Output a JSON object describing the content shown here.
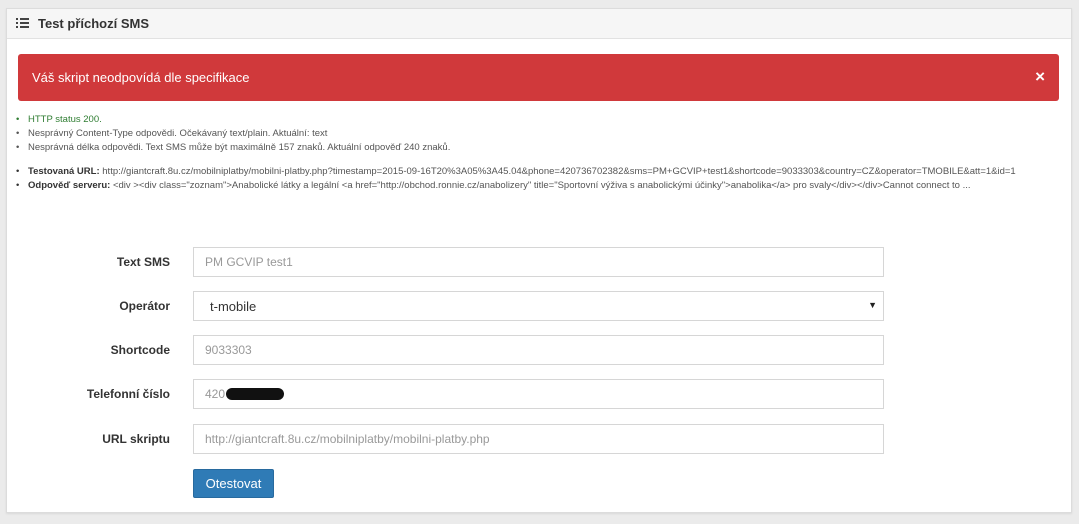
{
  "panel": {
    "title": "Test příchozí SMS",
    "icon": "list-icon"
  },
  "alert": {
    "text": "Váš skript neodpovídá dle specifikace",
    "close_icon": "×",
    "color": "#d0393b"
  },
  "messages": [
    {
      "text": "HTTP status 200.",
      "status": "ok"
    },
    {
      "text": "Nesprávný Content-Type odpovědi. Očekávaný text/plain. Aktuální: text",
      "status": "err"
    },
    {
      "text": "Nesprávná délka odpovědi. Text SMS může být maximálně 157 znaků. Aktuální odpověď 240 znaků.",
      "status": "err"
    }
  ],
  "details": {
    "tested_url_label": "Testovaná URL:",
    "tested_url_value": "http://giantcraft.8u.cz/mobilniplatby/mobilni-platby.php?timestamp=2015-09-16T20%3A05%3A45.04&phone=420736702382&sms=PM+GCVIP+test1&shortcode=9033303&country=CZ&operator=TMOBILE&att=1&id=1",
    "response_label": "Odpověď serveru:",
    "response_value": "<div ><div class=\"zoznam\">Anabolické látky a legální <a href=\"http://obchod.ronnie.cz/anabolizery\" title=\"Sportovní výživa s anabolickými účinky\">anabolika</a> pro svaly</div></div>Cannot connect to ..."
  },
  "form": {
    "text_sms": {
      "label": "Text SMS",
      "placeholder": "PM GCVIP test1"
    },
    "operator": {
      "label": "Operátor",
      "value": "t-mobile"
    },
    "shortcode": {
      "label": "Shortcode",
      "value": "9033303"
    },
    "phone": {
      "label": "Telefonní číslo",
      "value": "420"
    },
    "url": {
      "label": "URL skriptu",
      "placeholder": "http://giantcraft.8u.cz/mobilniplatby/mobilni-platby.php"
    },
    "submit_label": "Otestovat"
  },
  "colors": {
    "primary_button": "#2f7bb6",
    "ok_text": "#2f7d32"
  }
}
